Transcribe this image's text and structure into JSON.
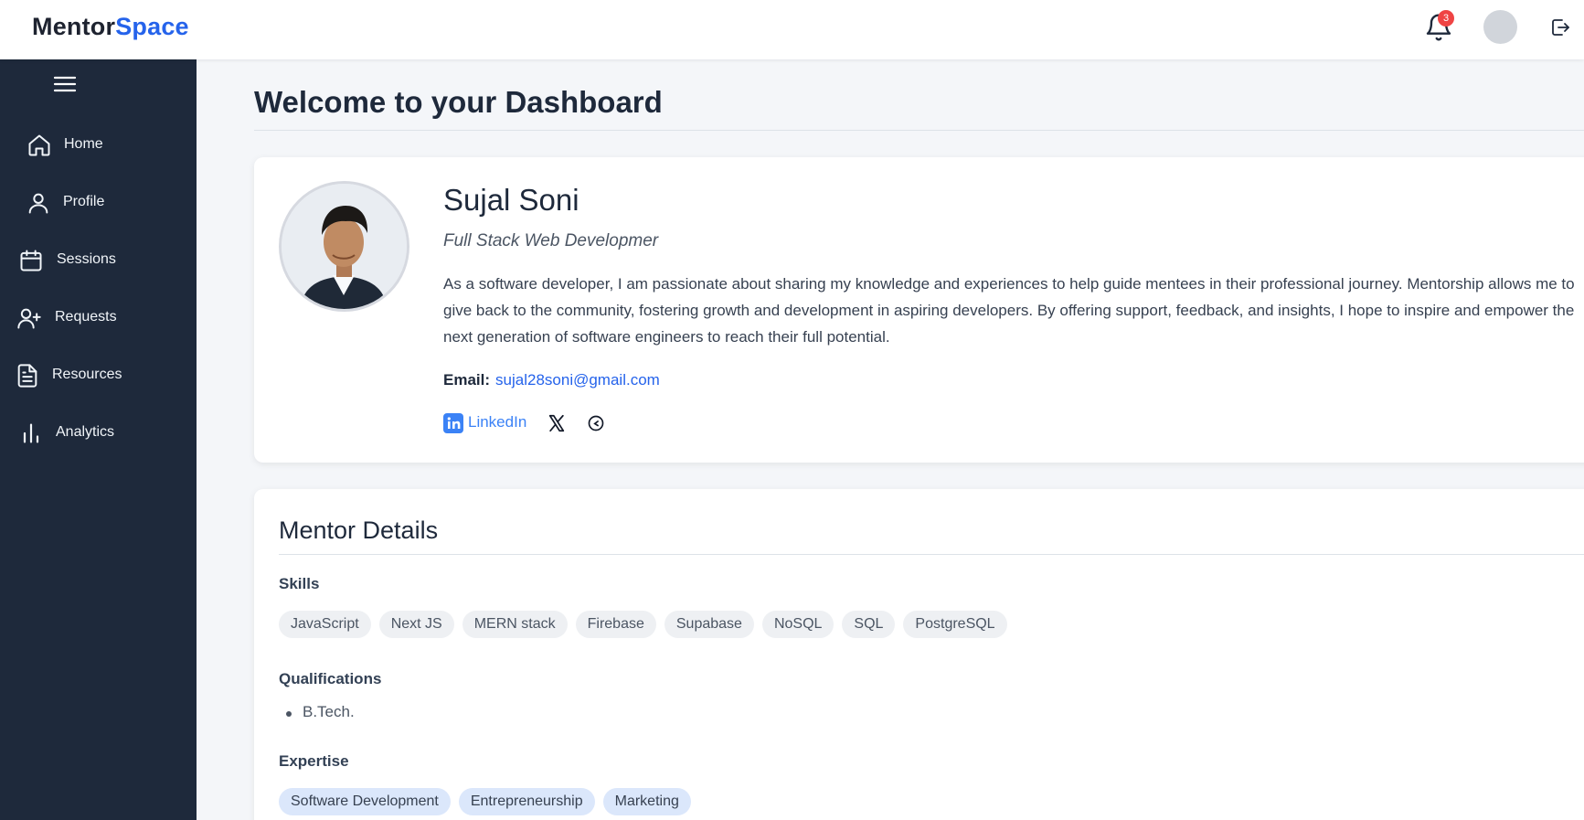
{
  "header": {
    "logo_part1": "Mentor",
    "logo_part2": "Space",
    "notification_count": "3"
  },
  "sidebar": {
    "items": [
      {
        "label": "Home",
        "icon": "home-icon"
      },
      {
        "label": "Profile",
        "icon": "user-icon"
      },
      {
        "label": "Sessions",
        "icon": "calendar-icon"
      },
      {
        "label": "Requests",
        "icon": "user-plus-icon"
      },
      {
        "label": "Resources",
        "icon": "document-icon"
      },
      {
        "label": "Analytics",
        "icon": "bar-chart-icon"
      }
    ]
  },
  "main": {
    "title": "Welcome to your Dashboard"
  },
  "profile": {
    "name": "Sujal Soni",
    "role": "Full Stack Web Developmer",
    "bio": "As a software developer, I am passionate about sharing my knowledge and experiences to help guide mentees in their professional journey. Mentorship allows me to give back to the community, fostering growth and development in aspiring developers. By offering support, feedback, and insights, I hope to inspire and empower the next generation of software engineers to reach their full potential.",
    "email_label": "Email:",
    "email": "sujal28soni@gmail.com",
    "linkedin_label": "LinkedIn"
  },
  "details": {
    "title": "Mentor Details",
    "skills_label": "Skills",
    "skills": [
      "JavaScript",
      "Next JS",
      "MERN stack",
      "Firebase",
      "Supabase",
      "NoSQL",
      "SQL",
      "PostgreSQL"
    ],
    "qualifications_label": "Qualifications",
    "qualifications": [
      "B.Tech."
    ],
    "expertise_label": "Expertise",
    "expertise": [
      "Software Development",
      "Entrepreneurship",
      "Marketing"
    ]
  },
  "colors": {
    "accent": "#2563eb",
    "sidebar_bg": "#1e293b",
    "badge": "#ef4444"
  }
}
